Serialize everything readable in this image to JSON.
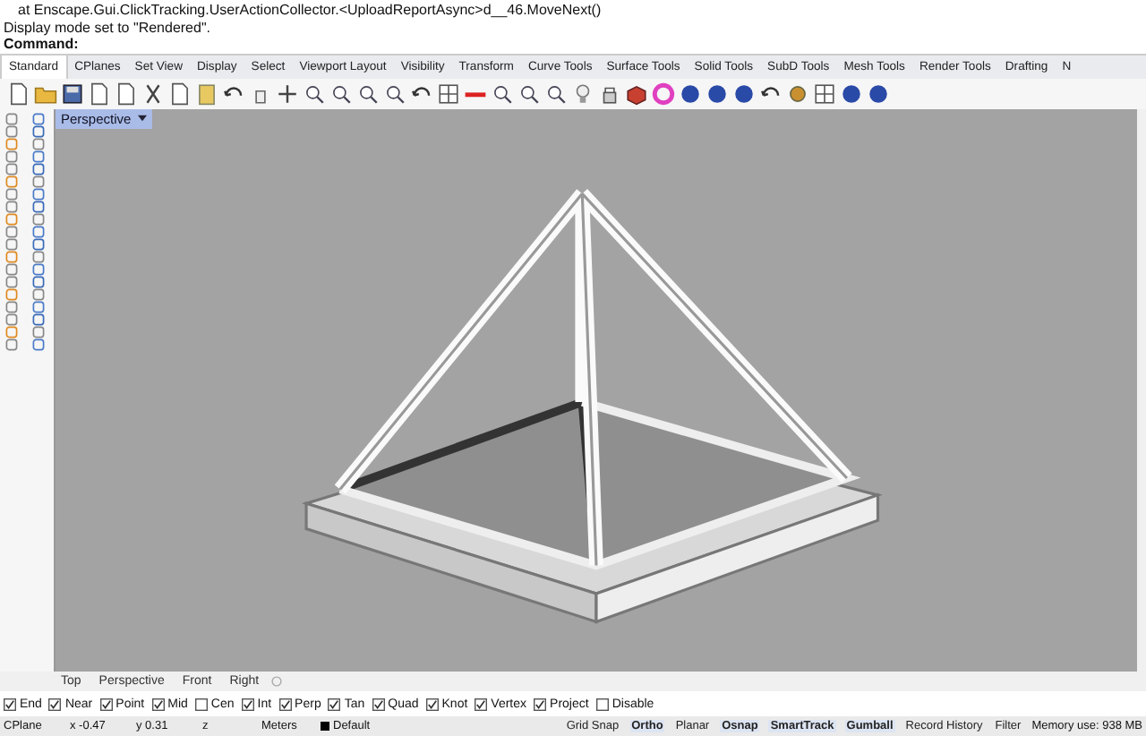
{
  "console": {
    "lines": [
      "at Enscape.Gui.ClickTracking.UserActionCollector.<UploadReportAsync>d__46.MoveNext()",
      "Display mode set to \"Rendered\"."
    ],
    "prompt": "Command:"
  },
  "tabs": [
    {
      "label": "Standard",
      "selected": true
    },
    {
      "label": "CPlanes",
      "selected": false
    },
    {
      "label": "Set View",
      "selected": false
    },
    {
      "label": "Display",
      "selected": false
    },
    {
      "label": "Select",
      "selected": false
    },
    {
      "label": "Viewport Layout",
      "selected": false
    },
    {
      "label": "Visibility",
      "selected": false
    },
    {
      "label": "Transform",
      "selected": false
    },
    {
      "label": "Curve Tools",
      "selected": false
    },
    {
      "label": "Surface Tools",
      "selected": false
    },
    {
      "label": "Solid Tools",
      "selected": false
    },
    {
      "label": "SubD Tools",
      "selected": false
    },
    {
      "label": "Mesh Tools",
      "selected": false
    },
    {
      "label": "Render Tools",
      "selected": false
    },
    {
      "label": "Drafting",
      "selected": false
    },
    {
      "label": "N",
      "selected": false
    }
  ],
  "viewport": {
    "title": "Perspective"
  },
  "viewport_tabs": [
    {
      "label": "Top"
    },
    {
      "label": "Perspective"
    },
    {
      "label": "Front"
    },
    {
      "label": "Right"
    }
  ],
  "osnaps": [
    {
      "label": "End",
      "checked": true
    },
    {
      "label": "Near",
      "checked": true
    },
    {
      "label": "Point",
      "checked": true
    },
    {
      "label": "Mid",
      "checked": true
    },
    {
      "label": "Cen",
      "checked": false
    },
    {
      "label": "Int",
      "checked": true
    },
    {
      "label": "Perp",
      "checked": true
    },
    {
      "label": "Tan",
      "checked": true
    },
    {
      "label": "Quad",
      "checked": true
    },
    {
      "label": "Knot",
      "checked": true
    },
    {
      "label": "Vertex",
      "checked": true
    },
    {
      "label": "Project",
      "checked": true
    },
    {
      "label": "Disable",
      "checked": false
    }
  ],
  "status_bar": {
    "cplane": "CPlane",
    "x": "x -0.47",
    "y": "y 0.31",
    "z": "z",
    "units": "Meters",
    "layer": "Default",
    "toggles": [
      {
        "label": "Grid Snap",
        "on": false
      },
      {
        "label": "Ortho",
        "on": true
      },
      {
        "label": "Planar",
        "on": false
      },
      {
        "label": "Osnap",
        "on": true
      },
      {
        "label": "SmartTrack",
        "on": true
      },
      {
        "label": "Gumball",
        "on": true
      },
      {
        "label": "Record History",
        "on": false
      },
      {
        "label": "Filter",
        "on": false
      }
    ],
    "memory": "Memory use: 938 MB"
  }
}
